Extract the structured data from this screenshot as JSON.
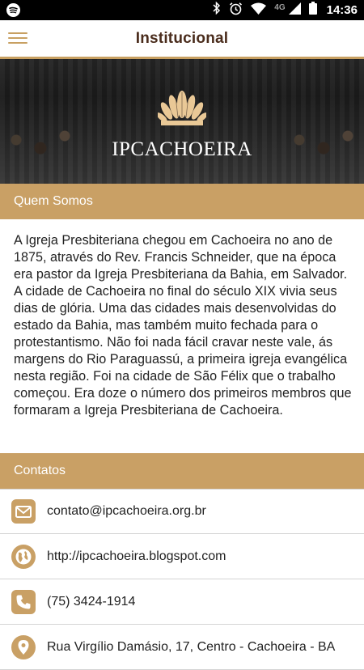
{
  "status_bar": {
    "time": "14:36",
    "network": "4G",
    "icons": [
      "spotify-icon",
      "bluetooth-icon",
      "alarm-icon",
      "wifi-icon",
      "signal-icon",
      "battery-icon"
    ]
  },
  "app_bar": {
    "title": "Institucional"
  },
  "banner": {
    "logo_text": "IPCACHOEIRA"
  },
  "about": {
    "header": "Quem Somos",
    "text": "A Igreja Presbiteriana chegou em Cachoeira no ano de 1875, através do Rev. Francis Schneider, que na época era pastor da Igreja Presbiteriana da Bahia, em Salvador. A cidade de Cachoeira no final do século XIX vivia seus dias de glória. Uma das cidades mais desenvolvidas do estado da Bahia, mas também muito fechada para o protestantismo. Não foi nada fácil cravar neste vale, ás margens do Rio Paraguassú, a primeira igreja evangélica nesta região. Foi na cidade de São Félix que o trabalho começou. Era doze o número dos primeiros membros que formaram a Igreja Presbiteriana de Cachoeira."
  },
  "contacts": {
    "header": "Contatos",
    "items": [
      {
        "icon": "email-icon",
        "text": "contato@ipcachoeira.org.br"
      },
      {
        "icon": "globe-icon",
        "text": "http://ipcachoeira.blogspot.com"
      },
      {
        "icon": "phone-icon",
        "text": "(75) 3424-1914"
      },
      {
        "icon": "location-icon",
        "text": "Rua Virgílio Damásio, 17, Centro - Cachoeira - BA"
      }
    ]
  },
  "colors": {
    "accent": "#c9a065",
    "title": "#4a2c1c"
  }
}
